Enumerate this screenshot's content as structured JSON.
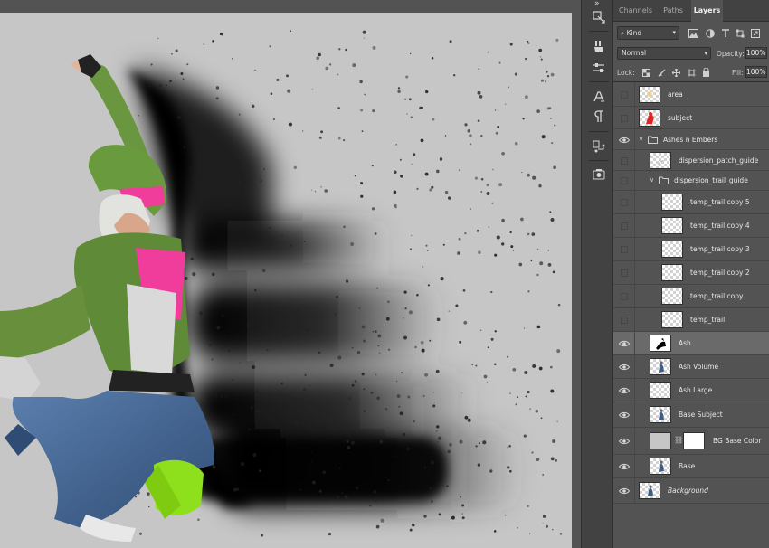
{
  "panel": {
    "collapse_glyph": "»",
    "tabs": [
      {
        "label": "Channels",
        "active": false
      },
      {
        "label": "Paths",
        "active": false
      },
      {
        "label": "Layers",
        "active": true
      }
    ],
    "filter": {
      "label": "Kind",
      "icons": [
        "image-filter-icon",
        "adjustment-filter-icon",
        "type-filter-icon",
        "shape-filter-icon",
        "smart-object-filter-icon"
      ]
    },
    "blend_mode": "Normal",
    "opacity": {
      "label": "Opacity:",
      "value": "100%"
    },
    "lock": {
      "label": "Lock:",
      "icons": [
        "lock-transparent-icon",
        "lock-paint-icon",
        "lock-position-icon",
        "lock-artboard-icon",
        "lock-all-icon"
      ]
    },
    "fill": {
      "label": "Fill:",
      "value": "100%"
    }
  },
  "layers": [
    {
      "name": "area",
      "visible": false,
      "indent": 0,
      "kind": "pixel",
      "thumb": "area"
    },
    {
      "name": "subject",
      "visible": false,
      "indent": 0,
      "kind": "pixel",
      "thumb": "subject-red"
    },
    {
      "name": "Ashes n Embers",
      "visible": true,
      "indent": 0,
      "kind": "group",
      "expanded": true
    },
    {
      "name": "dispersion_patch_guide",
      "visible": false,
      "indent": 1,
      "kind": "pixel",
      "thumb": "guide"
    },
    {
      "name": "dispersion_trail_guide",
      "visible": false,
      "indent": 1,
      "kind": "group",
      "expanded": true
    },
    {
      "name": "temp_trail copy 5",
      "visible": false,
      "indent": 2,
      "kind": "pixel",
      "thumb": "empty"
    },
    {
      "name": "temp_trail copy 4",
      "visible": false,
      "indent": 2,
      "kind": "pixel",
      "thumb": "empty"
    },
    {
      "name": "temp_trail copy 3",
      "visible": false,
      "indent": 2,
      "kind": "pixel",
      "thumb": "empty"
    },
    {
      "name": "temp_trail copy 2",
      "visible": false,
      "indent": 2,
      "kind": "pixel",
      "thumb": "empty"
    },
    {
      "name": "temp_trail copy",
      "visible": false,
      "indent": 2,
      "kind": "pixel",
      "thumb": "empty"
    },
    {
      "name": "temp_trail",
      "visible": false,
      "indent": 2,
      "kind": "pixel",
      "thumb": "empty"
    },
    {
      "name": "Ash",
      "visible": true,
      "indent": 1,
      "kind": "pixel",
      "thumb": "ash",
      "selected": true
    },
    {
      "name": "Ash Volume",
      "visible": true,
      "indent": 1,
      "kind": "pixel",
      "thumb": "figure"
    },
    {
      "name": "Ash Large",
      "visible": true,
      "indent": 1,
      "kind": "pixel",
      "thumb": "empty"
    },
    {
      "name": "Base Subject",
      "visible": true,
      "indent": 1,
      "kind": "pixel",
      "thumb": "figure"
    },
    {
      "name": "BG Base Color",
      "visible": true,
      "indent": 1,
      "kind": "fill",
      "thumb": "gray",
      "has_mask": true
    },
    {
      "name": "Base",
      "visible": true,
      "indent": 1,
      "kind": "pixel",
      "thumb": "figure"
    },
    {
      "name": "Background",
      "visible": true,
      "indent": 0,
      "kind": "background",
      "thumb": "figure",
      "italic": true
    }
  ],
  "tools": [
    "history-panel-icon",
    "brush-preset-icon",
    "brush-settings-icon",
    "character-icon",
    "paragraph-icon",
    "clone-source-icon",
    "tool-presets-icon"
  ],
  "colors": {
    "canvas_bg": "#c6c6c6",
    "panel_bg": "#535353",
    "tab_bar": "#424242",
    "selected_row": "#6a6a6a",
    "hoodie_green": "#5f8a37",
    "neon_green": "#8fe01c",
    "pink": "#f03c9a",
    "jeans": "#3b5f8f"
  }
}
